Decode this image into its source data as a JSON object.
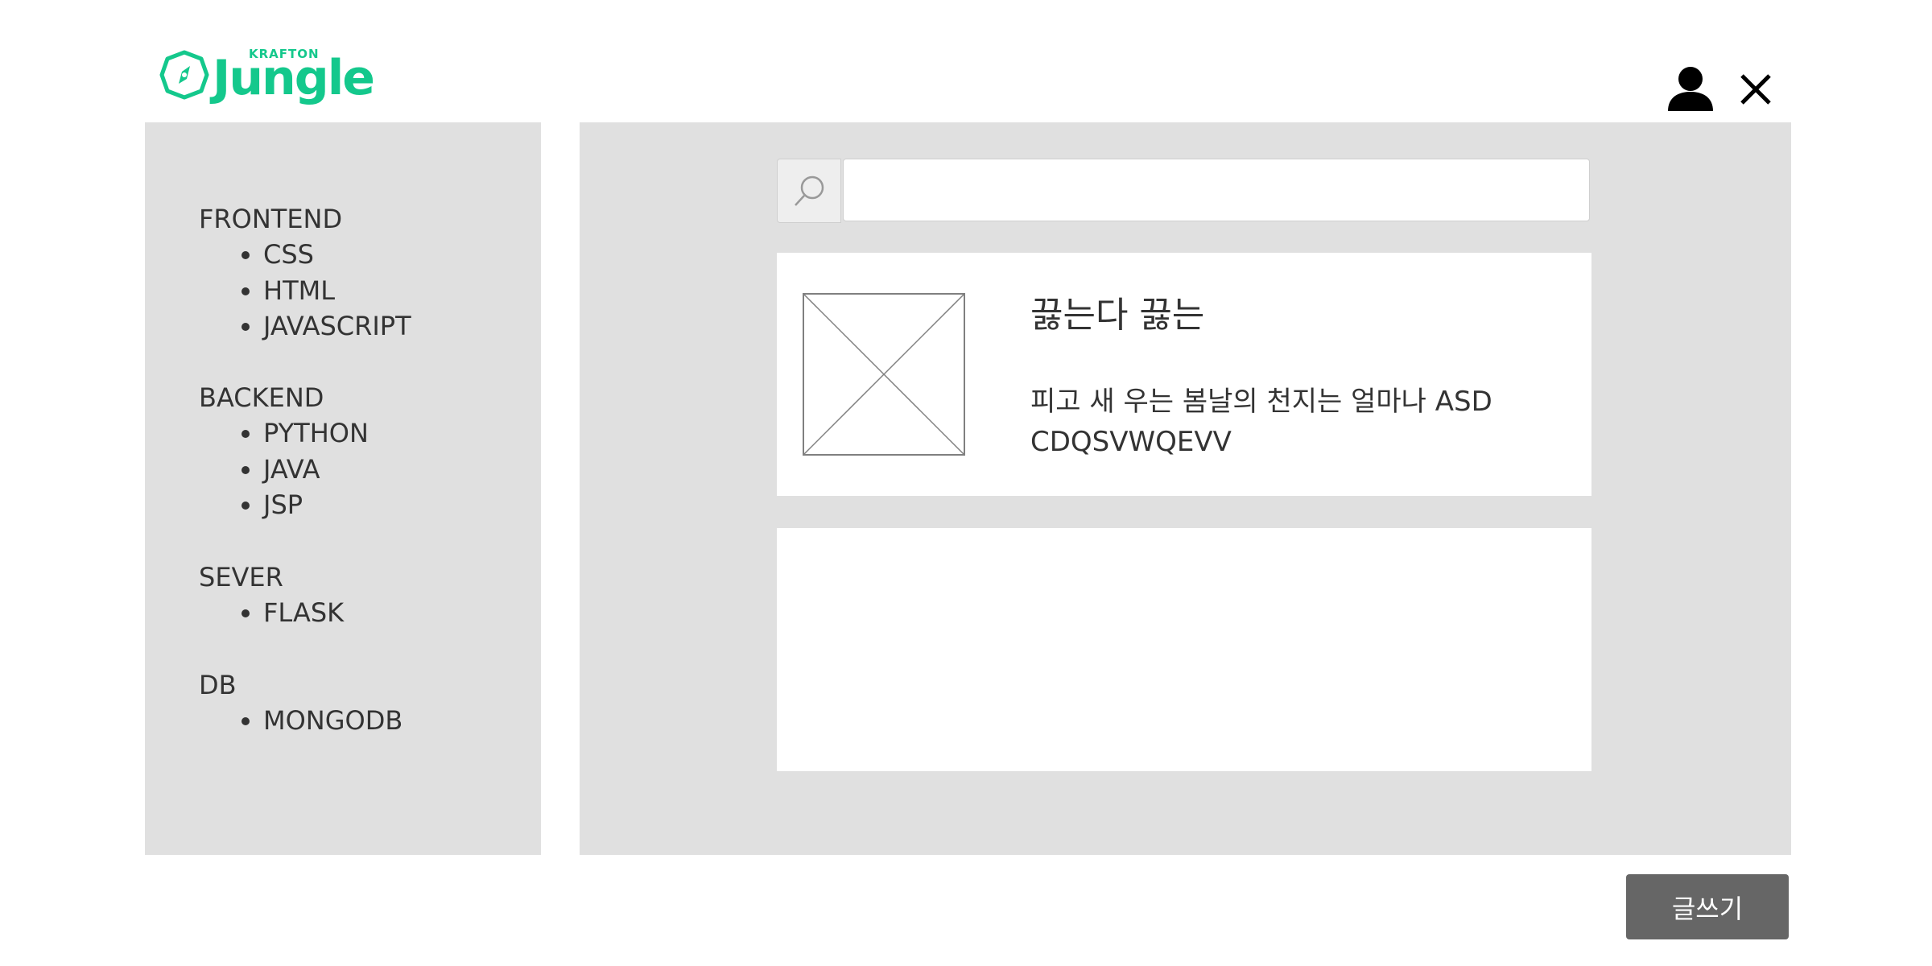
{
  "brand": {
    "top_text": "KRAFTON",
    "name": "Jungle",
    "color": "#14c88c"
  },
  "header": {
    "user_icon": "person-icon",
    "close_icon": "close-icon"
  },
  "sidebar": {
    "groups": [
      {
        "title": "FRONTEND",
        "items": [
          "CSS",
          "HTML",
          "JAVASCRIPT"
        ]
      },
      {
        "title": "BACKEND",
        "items": [
          "PYTHON",
          "JAVA",
          "JSP"
        ]
      },
      {
        "title": "SEVER",
        "items": [
          "FLASK"
        ]
      },
      {
        "title": "DB",
        "items": [
          "MONGODB"
        ]
      }
    ]
  },
  "search": {
    "icon": "search-icon",
    "value": "",
    "placeholder": ""
  },
  "posts": [
    {
      "title": "끓는다 끓는",
      "description": "피고 새 우는 봄날의 천지는 얼마나 ASD CDQSVWQEVV",
      "thumbnail": "image-placeholder-icon"
    },
    {
      "title": "",
      "description": ""
    }
  ],
  "actions": {
    "write_label": "글쓰기"
  },
  "colors": {
    "panel_bg": "#e0e0e0",
    "button_bg": "#666666",
    "accent": "#14c88c"
  }
}
